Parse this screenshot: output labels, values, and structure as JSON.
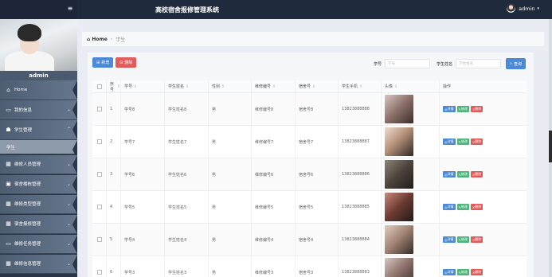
{
  "header": {
    "title": "高校宿舍报修管理系统",
    "user": "admin",
    "caret": "▾",
    "menu_icon": "≡"
  },
  "sidebar": {
    "username": "admin",
    "items": [
      {
        "label": "Home",
        "icon": "home-icon",
        "glyph": "⌂"
      },
      {
        "label": "我的信息",
        "icon": "card-icon",
        "glyph": "▭"
      },
      {
        "label": "学生管理",
        "icon": "student-icon",
        "glyph": "☗",
        "expanded": true
      },
      {
        "label": "学生",
        "sub": true
      },
      {
        "label": "维修人员管理",
        "icon": "grid-icon",
        "glyph": "▦"
      },
      {
        "label": "宿舍楼栋管理",
        "icon": "building-icon",
        "glyph": "▣"
      },
      {
        "label": "维修类型管理",
        "icon": "grid-icon",
        "glyph": "▦"
      },
      {
        "label": "宿舍报修管理",
        "icon": "grid-icon",
        "glyph": "▦"
      },
      {
        "label": "维修任务管理",
        "icon": "monitor-icon",
        "glyph": "▭"
      },
      {
        "label": "维修信息管理",
        "icon": "grid-icon",
        "glyph": "▦"
      }
    ]
  },
  "breadcrumb": {
    "home": "Home",
    "separator": "›",
    "current": "学生"
  },
  "toolbar": {
    "add_label": "新增",
    "delete_label": "删除"
  },
  "search": {
    "no_label": "学号",
    "no_placeholder": "学号",
    "name_label": "学生姓名",
    "name_placeholder": "学生姓名",
    "button_label": "查询"
  },
  "table": {
    "columns": [
      "序号",
      "学号",
      "学生姓名",
      "性别",
      "维修编号",
      "宿舍号",
      "学生手机",
      "头像",
      "操作"
    ],
    "sort_glyph": "⇕",
    "rows": [
      {
        "idx": "1",
        "no": "学号8",
        "name": "学生姓名8",
        "sex": "男",
        "repno": "维修编号8",
        "dorm": "宿舍号8",
        "phone": "13823888888"
      },
      {
        "idx": "2",
        "no": "学号7",
        "name": "学生姓名7",
        "sex": "男",
        "repno": "维修编号7",
        "dorm": "宿舍号7",
        "phone": "13823888887"
      },
      {
        "idx": "3",
        "no": "学号6",
        "name": "学生姓名6",
        "sex": "男",
        "repno": "维修编号6",
        "dorm": "宿舍号6",
        "phone": "13823888886"
      },
      {
        "idx": "4",
        "no": "学号5",
        "name": "学生姓名5",
        "sex": "男",
        "repno": "维修编号5",
        "dorm": "宿舍号5",
        "phone": "13823888885"
      },
      {
        "idx": "5",
        "no": "学号4",
        "name": "学生姓名4",
        "sex": "男",
        "repno": "维修编号4",
        "dorm": "宿舍号4",
        "phone": "13823888884"
      },
      {
        "idx": "6",
        "no": "学号3",
        "name": "学生姓名3",
        "sex": "男",
        "repno": "维修编号3",
        "dorm": "宿舍号3",
        "phone": "13823888883"
      }
    ],
    "ops": {
      "detail": "详情",
      "edit": "修改",
      "delete": "删除"
    }
  }
}
